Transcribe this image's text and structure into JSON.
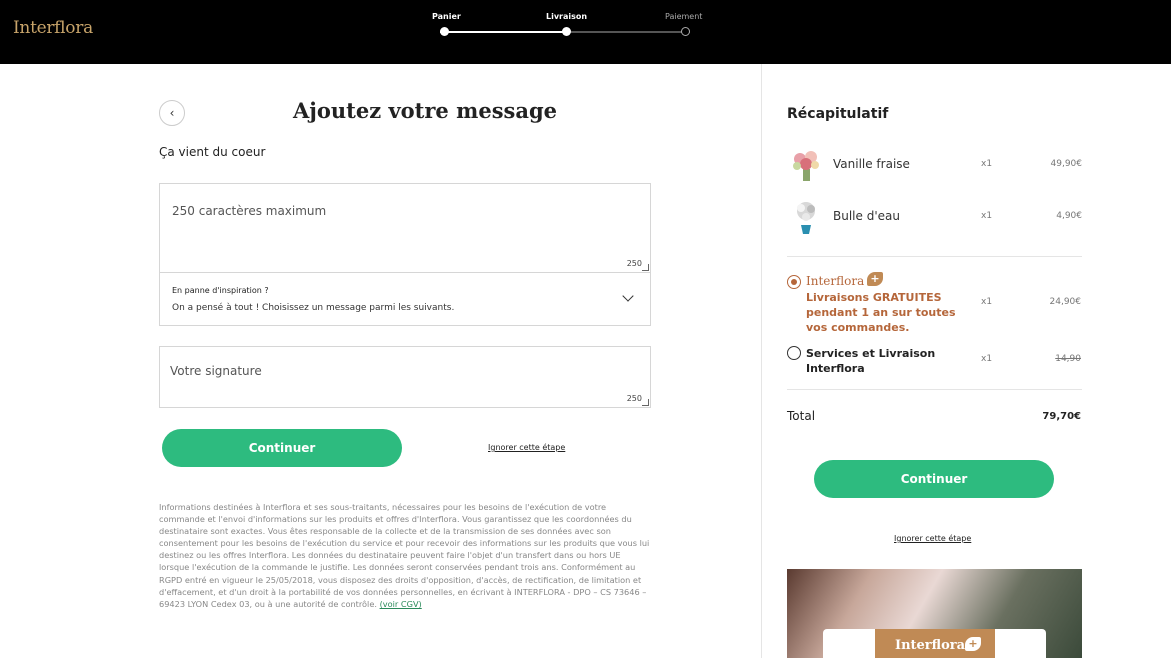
{
  "header": {
    "logo": "Interflora",
    "steps": [
      {
        "label": "Panier",
        "state": "done"
      },
      {
        "label": "Livraison",
        "state": "current"
      },
      {
        "label": "Paiement",
        "state": "todo"
      }
    ],
    "progress_fraction": 0.5
  },
  "main": {
    "back_icon": "chevron-left-icon",
    "title": "Ajoutez votre message",
    "subtitle": "Ça vient du coeur",
    "message": {
      "placeholder": "250 caractères maximum",
      "counter": "250"
    },
    "inspiration": {
      "title": "En panne d'inspiration ?",
      "text": "On a pensé à tout ! Choisissez un message parmi les suivants."
    },
    "signature": {
      "placeholder": "Votre signature",
      "counter": "250"
    },
    "continue_label": "Continuer",
    "skip_label": "Ignorer cette étape",
    "legal_text": "Informations destinées à Interflora et ses sous-traitants, nécessaires pour les besoins de l'exécution de votre commande et l'envoi d'informations sur les produits et offres d'Interflora. Vous garantissez que les coordonnées du destinataire sont exactes. Vous êtes responsable de la collecte et de la transmission de ses données avec son consentement pour les besoins de l'exécution du service et pour recevoir des informations sur les produits que vous lui destinez ou les offres Interflora. Les données du destinataire peuvent faire l'objet d'un transfert dans ou hors UE lorsque l'exécution de la commande le justifie. Les données seront conservées pendant trois ans. Conformément au RGPD entré en vigueur le 25/05/2018, vous disposez des droits d'opposition, d'accès, de rectification, de limitation et d'effacement, et d'un droit à la portabilité de vos données personnelles, en écrivant à INTERFLORA - DPO – CS 73646 – 69423 LYON Cedex 03, ou à une autorité de contrôle.",
    "legal_link": "(voir CGV)"
  },
  "summary": {
    "title": "Récapitulatif",
    "items": [
      {
        "name": "Vanille fraise",
        "qty": "x1",
        "price": "49,90€"
      },
      {
        "name": "Bulle d'eau",
        "qty": "x1",
        "price": "4,90€"
      }
    ],
    "options": [
      {
        "brand": "Interflora",
        "badge": "+",
        "text": "Livraisons GRATUITES pendant 1 an sur toutes vos commandes.",
        "qty": "x1",
        "price": "24,90€",
        "selected": true,
        "color": "#b5663a"
      },
      {
        "text": "Services et Livraison Interflora",
        "qty": "x1",
        "price": "14,90",
        "selected": false
      }
    ],
    "total_label": "Total",
    "total_value": "79,70€",
    "continue_label": "Continuer",
    "skip_label": "Ignorer cette étape",
    "promo_logo": "Interflora",
    "promo_badge": "+"
  },
  "colors": {
    "accent_green": "#2dbb7f",
    "brand_gold": "#c8a46a",
    "brand_copper": "#b5663a"
  }
}
